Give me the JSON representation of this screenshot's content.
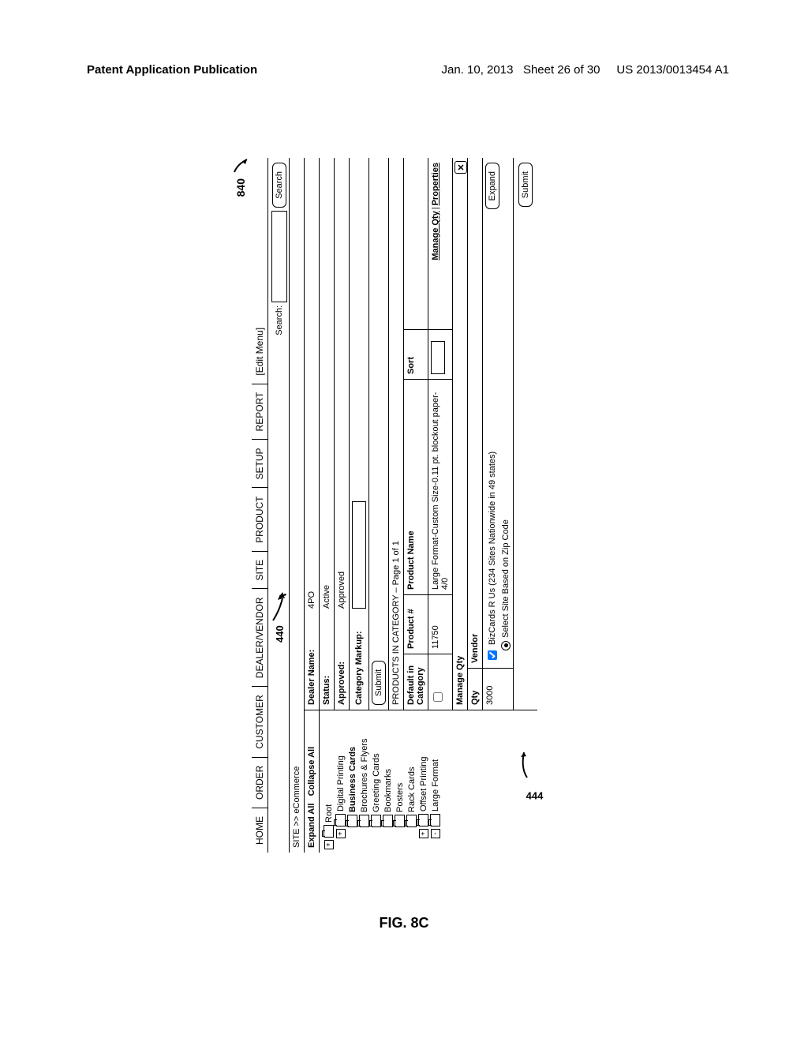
{
  "doc_header": {
    "left": "Patent Application Publication",
    "center_date": "Jan. 10, 2013",
    "sheet": "Sheet 26 of 30",
    "pubno": "US 2013/0013454 A1"
  },
  "menu": {
    "items": [
      "HOME",
      "ORDER",
      "CUSTOMER",
      "DEALER/VENDOR",
      "SITE",
      "PRODUCT",
      "SETUP",
      "REPORT"
    ],
    "edit": "[Edit Menu]"
  },
  "header": {
    "cursor_ref": "440",
    "search_label": "Search:",
    "search_btn": "Search"
  },
  "breadcrumb": "SITE  >>  eCommerce",
  "tree": {
    "expand": "Expand All",
    "collapse": "Collapse All",
    "nodes": [
      {
        "depth": 1,
        "box": "+",
        "folder": true,
        "label": "Root"
      },
      {
        "depth": 2,
        "box": "+",
        "folder": true,
        "label": "Digital Printing"
      },
      {
        "depth": 3,
        "folder": true,
        "label": "Business Cards",
        "bold": true
      },
      {
        "depth": 3,
        "folder": true,
        "label": "Brochures & Flyers"
      },
      {
        "depth": 3,
        "folder": true,
        "label": "Greeting Cards"
      },
      {
        "depth": 3,
        "folder": true,
        "label": "Bookmarks"
      },
      {
        "depth": 3,
        "folder": true,
        "label": "Posters"
      },
      {
        "depth": 3,
        "folder": true,
        "label": "Rack Cards"
      },
      {
        "depth": 2,
        "box": "+",
        "folder": true,
        "label": "Offset Printing"
      },
      {
        "depth": 2,
        "box": "-",
        "folder": true,
        "label": "Large Format"
      }
    ]
  },
  "right": {
    "dealer_name_label": "Dealer Name:",
    "dealer_name_value": "4PO",
    "status_label": "Status:",
    "status_value": "Active",
    "approved_label": "Approved:",
    "approved_value": "Approved",
    "markup_label": "Category Markup:",
    "markup_submit": "Submit",
    "products_header": "PRODUCTS IN CATEGORY – Page 1 of 1",
    "cols": {
      "default": "Default in Category",
      "product_no": "Product #",
      "product_name": "Product Name",
      "sort": "Sort"
    },
    "row": {
      "default_checked": false,
      "product_no": "11750",
      "product_name": "Large Format-Custom Size-0.11 pt. blockout paper-4/0",
      "manage_link": "Manage Qty",
      "props_link": "Properties"
    },
    "mq": {
      "title": "Manage Qty",
      "qty_col": "Qty",
      "vendor_col": "Vendor",
      "qty_value": "3000",
      "vendor_check_label": "BizCards R Us (234 Sites Nationwide in 49 states)",
      "vendor_radio_label": "Select Site Based on Zip Code",
      "expand_btn": "Expand"
    },
    "submit_btn": "Submit"
  },
  "callouts": {
    "fig_ref": "840",
    "panel_ref": "444"
  },
  "figure_label": "FIG. 8C"
}
